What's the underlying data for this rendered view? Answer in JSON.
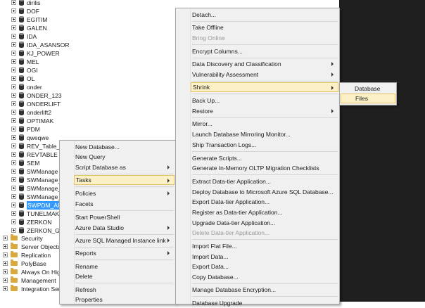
{
  "tree": {
    "databases": [
      "dirilis",
      "DOF",
      "EGITIM",
      "GALEN",
      "IDA",
      "IDA_ASANSOR",
      "KJ_POWER",
      "MEL",
      "OGI",
      "OL",
      "onder",
      "ONDER_123",
      "ONDERLIFT",
      "onderlift2",
      "OPTIMAK",
      "PDM",
      "qweqwe",
      "REV_Table_N",
      "REVTABLE",
      "SEM",
      "SWManage",
      "SWManage_",
      "SWManage_",
      "SWManage_",
      "SWPDM_AR",
      "TUNELMAK",
      "ZERKON",
      "ZERKON_GU"
    ],
    "folders": [
      "Security",
      "Server Objects",
      "Replication",
      "PolyBase",
      "Always On High",
      "Management",
      "Integration Serv"
    ]
  },
  "context_menu": {
    "items": [
      "New Database...",
      "New Query",
      "Script Database as",
      "Tasks",
      "Policies",
      "Facets",
      "Start PowerShell",
      "Azure Data Studio",
      "Azure SQL Managed Instance link",
      "Reports",
      "Rename",
      "Delete",
      "Refresh",
      "Properties"
    ]
  },
  "tasks_menu": {
    "items": [
      "Detach...",
      "Take Offline",
      "Bring Online",
      "Encrypt Columns...",
      "Data Discovery and Classification",
      "Vulnerability Assessment",
      "Shrink",
      "Back Up...",
      "Restore",
      "Mirror...",
      "Launch Database Mirroring Monitor...",
      "Ship Transaction Logs...",
      "Generate Scripts...",
      "Generate In-Memory OLTP Migration Checklists",
      "Extract Data-tier Application...",
      "Deploy Database to Microsoft Azure SQL Database...",
      "Export Data-tier Application...",
      "Register as Data-tier Application...",
      "Upgrade Data-tier Application...",
      "Delete Data-tier Application...",
      "Import Flat File...",
      "Import Data...",
      "Export Data...",
      "Copy Database...",
      "Manage Database Encryption...",
      "Database Upgrade"
    ]
  },
  "shrink_menu": {
    "items": [
      "Database",
      "Files"
    ]
  }
}
